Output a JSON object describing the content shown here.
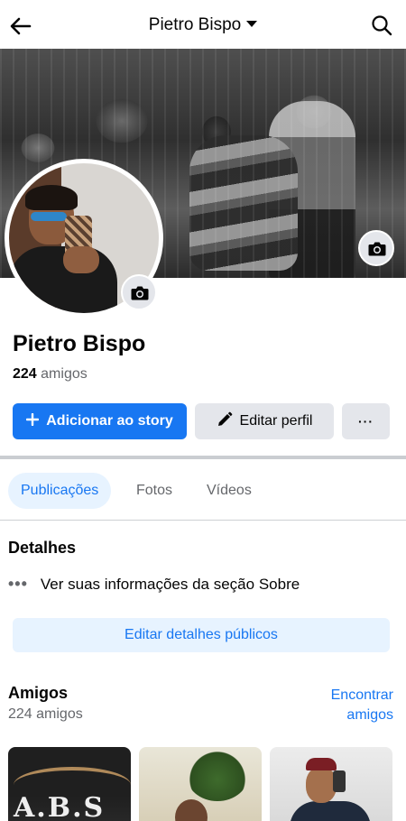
{
  "header": {
    "title": "Pietro Bispo",
    "back_icon": "arrow-left-icon",
    "dropdown_icon": "caret-down-icon",
    "search_icon": "search-icon"
  },
  "profile": {
    "name": "Pietro Bispo",
    "friends_number": "224",
    "friends_suffix": "amigos",
    "cover_camera_icon": "camera-icon",
    "avatar_camera_icon": "camera-icon"
  },
  "actions": {
    "add_story": "Adicionar ao story",
    "edit_profile": "Editar perfil",
    "more": "···"
  },
  "tabs": [
    {
      "label": "Publicações",
      "active": true
    },
    {
      "label": "Fotos",
      "active": false
    },
    {
      "label": "Vídeos",
      "active": false
    }
  ],
  "details": {
    "title": "Detalhes",
    "about_link": "Ver suas informações da seção Sobre",
    "edit_public": "Editar detalhes públicos"
  },
  "friends": {
    "title": "Amigos",
    "count": "224 amigos",
    "find_line1": "Encontrar",
    "find_line2": "amigos",
    "thumb1_text": "A.B.S"
  },
  "colors": {
    "accent": "#1877f2",
    "accent_light": "#e7f3ff",
    "secondary_button": "#e4e6eb",
    "muted_text": "#65676b"
  }
}
